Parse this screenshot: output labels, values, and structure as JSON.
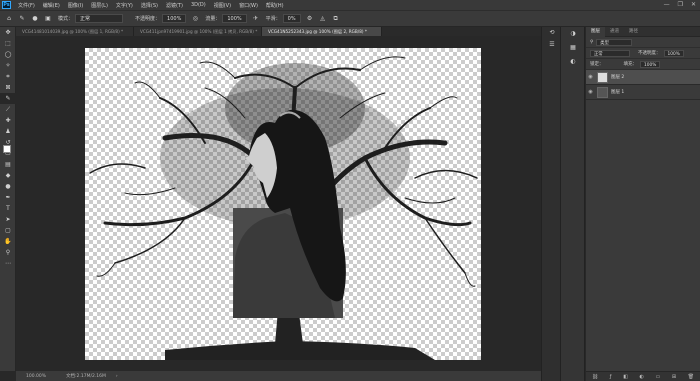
{
  "menubar": {
    "logo": "Ps",
    "items": [
      "文件(F)",
      "编辑(E)",
      "图像(I)",
      "图层(L)",
      "文字(Y)",
      "选择(S)",
      "滤镜(T)",
      "3D(D)",
      "视图(V)",
      "窗口(W)",
      "帮助(H)"
    ],
    "window_controls": [
      "—",
      "❐",
      "✕"
    ]
  },
  "options": {
    "mode_label": "模式：",
    "mode_value": "正常",
    "opacity_label": "不透明度：",
    "opacity_value": "100%",
    "flow_label": "流量：",
    "flow_value": "100%",
    "smoothing_label": "平滑：",
    "smoothing_value": "0%"
  },
  "tabs": [
    {
      "label": "VCG41481014039.jpg @ 100% (图层 1, RGB/8) *"
    },
    {
      "label": "VCG411jpn97419901.jpg @ 100% (图层 1 拷贝, RGB/8) *"
    },
    {
      "label": "VCG41N5252343.jpg @ 100% (图层 2, RGB/8) *"
    }
  ],
  "status": {
    "zoom": "100.00%",
    "doc_size": "文档:2.17M/2.16M"
  },
  "layers_panel": {
    "tabs": [
      "图层",
      "通道",
      "路径"
    ],
    "filter_label": "类型",
    "blend_mode": "正常",
    "opacity_label": "不透明度：",
    "opacity_value": "100%",
    "lock_label": "锁定：",
    "fill_label": "填充：",
    "fill_value": "100%",
    "layers": [
      {
        "name": "图层 2"
      },
      {
        "name": "图层 1"
      }
    ]
  },
  "colors": {
    "accent": "#31a8ff",
    "panel_bg": "#3a3a3a",
    "canvas_bg": "#282828",
    "tree": "#202020"
  }
}
